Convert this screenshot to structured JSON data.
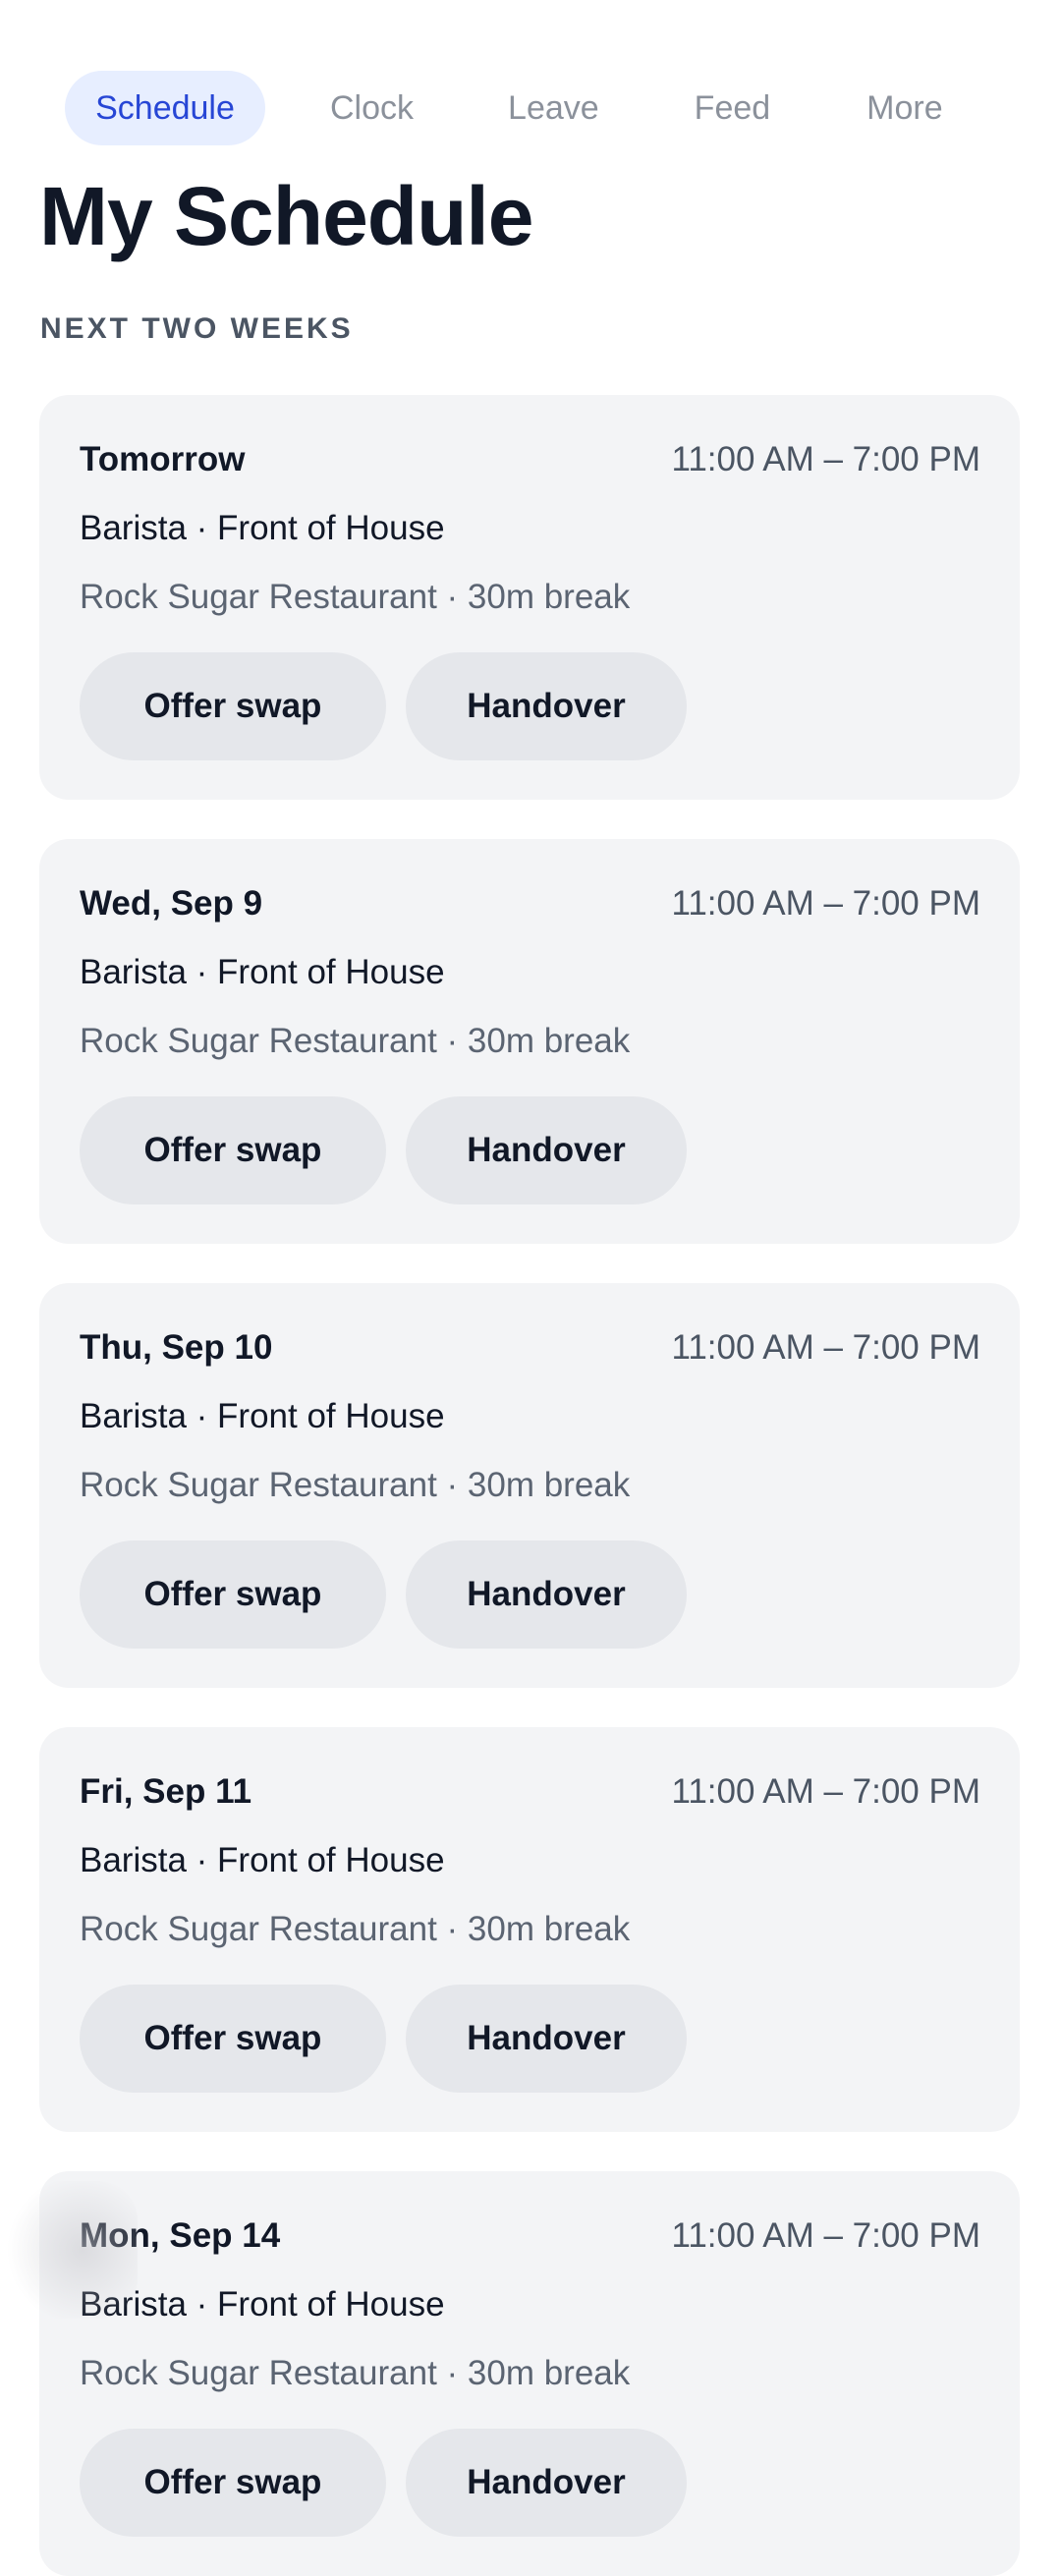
{
  "nav": {
    "tabs": [
      {
        "label": "Schedule",
        "active": true
      },
      {
        "label": "Clock",
        "active": false
      },
      {
        "label": "Leave",
        "active": false
      },
      {
        "label": "Feed",
        "active": false
      },
      {
        "label": "More",
        "active": false
      }
    ]
  },
  "page": {
    "title": "My Schedule",
    "section_label": "NEXT TWO WEEKS"
  },
  "shifts": [
    {
      "day": "Tomorrow",
      "time": "11:00 AM – 7:00 PM",
      "role": "Barista · Front of House",
      "location": "Rock Sugar Restaurant · 30m break",
      "swap_label": "Offer swap",
      "handover_label": "Handover"
    },
    {
      "day": "Wed, Sep 9",
      "time": "11:00 AM – 7:00 PM",
      "role": "Barista · Front of House",
      "location": "Rock Sugar Restaurant · 30m break",
      "swap_label": "Offer swap",
      "handover_label": "Handover"
    },
    {
      "day": "Thu, Sep 10",
      "time": "11:00 AM – 7:00 PM",
      "role": "Barista · Front of House",
      "location": "Rock Sugar Restaurant · 30m break",
      "swap_label": "Offer swap",
      "handover_label": "Handover"
    },
    {
      "day": "Fri, Sep 11",
      "time": "11:00 AM – 7:00 PM",
      "role": "Barista · Front of House",
      "location": "Rock Sugar Restaurant · 30m break",
      "swap_label": "Offer swap",
      "handover_label": "Handover"
    },
    {
      "day": "Mon, Sep 14",
      "time": "11:00 AM – 7:00 PM",
      "role": "Barista · Front of House",
      "location": "Rock Sugar Restaurant · 30m break",
      "swap_label": "Offer swap",
      "handover_label": "Handover"
    }
  ],
  "colors": {
    "accent": "#2746d5",
    "active_tab_bg": "#e7eeff",
    "card_bg": "#f3f4f6",
    "button_bg": "#e5e7eb",
    "muted_text": "#5b6472"
  }
}
